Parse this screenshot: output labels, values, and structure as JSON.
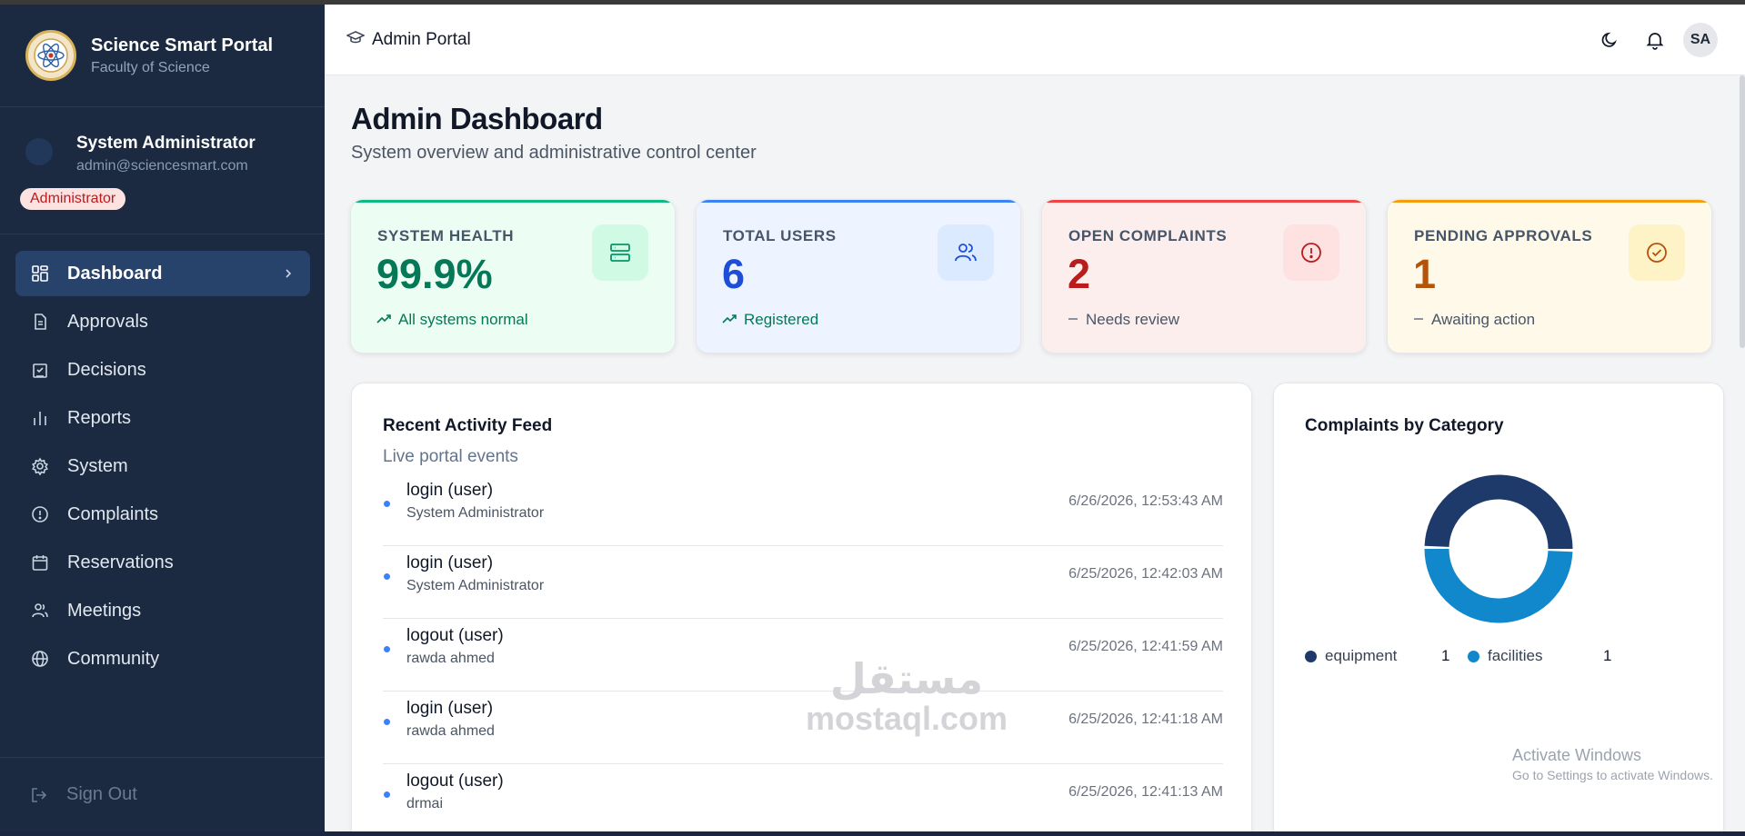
{
  "brand": {
    "title": "Science Smart Portal",
    "subtitle": "Faculty of Science",
    "logo_icon": "atom-seal-icon"
  },
  "profile": {
    "name": "System Administrator",
    "email": "admin@sciencesmart.com",
    "role": "Administrator"
  },
  "nav": [
    {
      "label": "Dashboard",
      "icon": "grid-icon",
      "active": true
    },
    {
      "label": "Approvals",
      "icon": "document-icon"
    },
    {
      "label": "Decisions",
      "icon": "clipboard-check-icon"
    },
    {
      "label": "Reports",
      "icon": "bar-chart-icon"
    },
    {
      "label": "System",
      "icon": "gear-icon"
    },
    {
      "label": "Complaints",
      "icon": "alert-circle-icon"
    },
    {
      "label": "Reservations",
      "icon": "calendar-icon"
    },
    {
      "label": "Meetings",
      "icon": "users-icon"
    },
    {
      "label": "Community",
      "icon": "globe-icon"
    }
  ],
  "signout": "Sign Out",
  "topbar": {
    "title": "Admin Portal",
    "avatar": "SA"
  },
  "page": {
    "title": "Admin Dashboard",
    "subtitle": "System overview and administrative control center"
  },
  "cards": [
    {
      "label": "SYSTEM HEALTH",
      "value": "99.9%",
      "footer": "All systems normal",
      "icon": "server-icon",
      "color": "#047857",
      "bg": "#ecfdf3",
      "accent": "#10b981"
    },
    {
      "label": "TOTAL USERS",
      "value": "6",
      "footer": "Registered",
      "icon": "users-icon",
      "color": "#1d4ed8",
      "bg": "#eef4ff",
      "accent": "#3b82f6"
    },
    {
      "label": "OPEN COMPLAINTS",
      "value": "2",
      "footer": "Needs review",
      "icon": "alert-circle-icon",
      "color": "#b91c1c",
      "bg": "#fdeeee",
      "accent": "#ef4444"
    },
    {
      "label": "PENDING APPROVALS",
      "value": "1",
      "footer": "Awaiting action",
      "icon": "check-circle-icon",
      "color": "#b45309",
      "bg": "#fef9e8",
      "accent": "#f59e0b"
    }
  ],
  "feed": {
    "title": "Recent Activity Feed",
    "subtitle": "Live portal events",
    "items": [
      {
        "title": "login (user)",
        "user": "System Administrator",
        "time": "6/26/2026, 12:53:43 AM"
      },
      {
        "title": "login (user)",
        "user": "System Administrator",
        "time": "6/25/2026, 12:42:03 AM"
      },
      {
        "title": "logout (user)",
        "user": "rawda ahmed",
        "time": "6/25/2026, 12:41:59 AM"
      },
      {
        "title": "login (user)",
        "user": "rawda ahmed",
        "time": "6/25/2026, 12:41:18 AM"
      },
      {
        "title": "logout (user)",
        "user": "drmai",
        "time": "6/25/2026, 12:41:13 AM"
      }
    ]
  },
  "chart_data": {
    "type": "pie",
    "title": "Complaints by Category",
    "categories": [
      "equipment",
      "facilities"
    ],
    "values": [
      1,
      1
    ],
    "colors": [
      "#1e3a6b",
      "#1188cc"
    ],
    "donut": true,
    "legend": "bottom"
  },
  "watermark": {
    "arabic": "مستقل",
    "latin": "mostaql.com"
  },
  "activate": {
    "title": "Activate Windows",
    "sub": "Go to Settings to activate Windows."
  }
}
